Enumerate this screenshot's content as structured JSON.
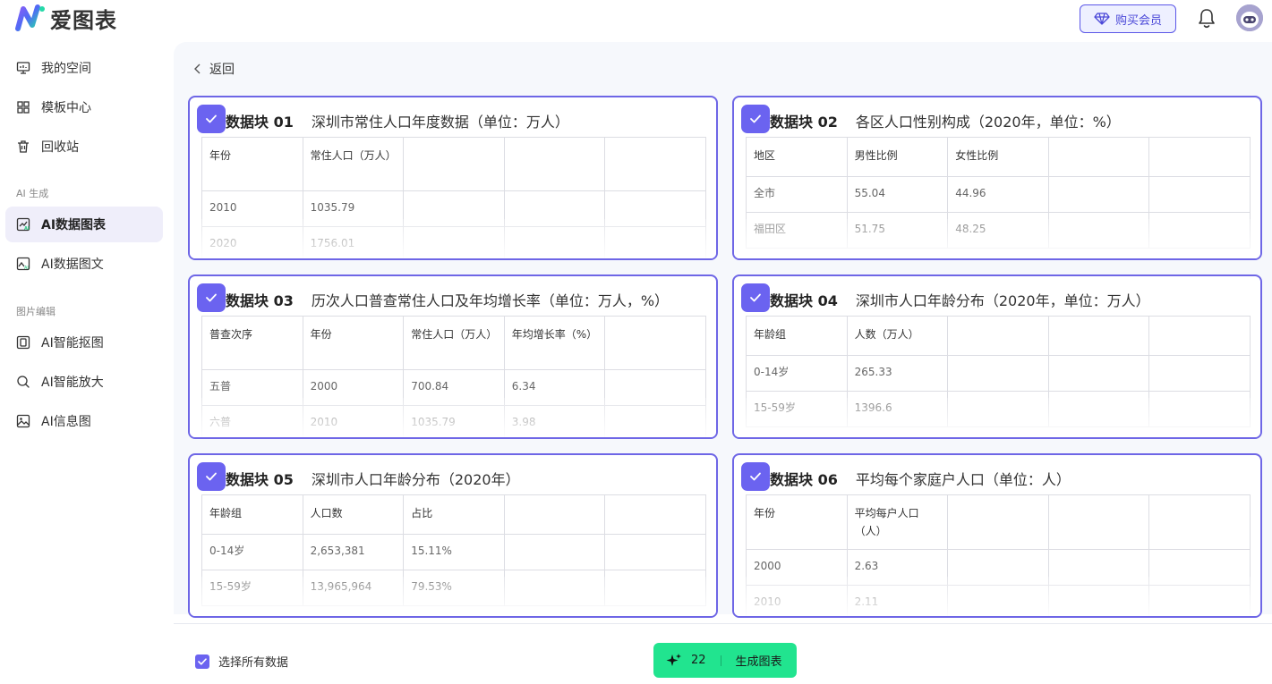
{
  "app": {
    "name": "爱图表"
  },
  "header": {
    "vip_label": "购买会员"
  },
  "sidebar": {
    "items": [
      {
        "label": "我的空间",
        "icon": "monitor-icon"
      },
      {
        "label": "模板中心",
        "icon": "grid-icon"
      },
      {
        "label": "回收站",
        "icon": "trash-icon"
      }
    ],
    "section_ai": "AI 生成",
    "ai_items": [
      {
        "label": "AI数据图表",
        "icon": "ai-chart-icon",
        "active": true
      },
      {
        "label": "AI数据图文",
        "icon": "ai-image-text-icon"
      }
    ],
    "section_edit": "图片编辑",
    "edit_items": [
      {
        "label": "AI智能抠图",
        "icon": "cutout-icon"
      },
      {
        "label": "AI智能放大",
        "icon": "magnify-icon"
      },
      {
        "label": "AI信息图",
        "icon": "image-icon"
      }
    ]
  },
  "main": {
    "back_label": "返回",
    "cards": [
      {
        "label": "数据块 01",
        "title": "深圳市常住人口年度数据（单位：万人）",
        "headers": [
          "年份",
          "常住人口（万人）",
          "",
          "",
          ""
        ],
        "rows": [
          [
            "2010",
            "1035.79",
            "",
            "",
            ""
          ],
          [
            "2020",
            "1756.01",
            "",
            "",
            ""
          ]
        ]
      },
      {
        "label": "数据块 02",
        "title": "各区人口性别构成（2020年，单位：%）",
        "headers": [
          "地区",
          "男性比例",
          "女性比例",
          "",
          ""
        ],
        "rows": [
          [
            "全市",
            "55.04",
            "44.96",
            "",
            ""
          ],
          [
            "福田区",
            "51.75",
            "48.25",
            "",
            ""
          ]
        ]
      },
      {
        "label": "数据块 03",
        "title": "历次人口普查常住人口及年均增长率（单位：万人，%）",
        "headers": [
          "普查次序",
          "年份",
          "常住人口（万人）",
          "年均增长率（%）",
          ""
        ],
        "rows": [
          [
            "五普",
            "2000",
            "700.84",
            "6.34",
            ""
          ],
          [
            "六普",
            "2010",
            "1035.79",
            "3.98",
            ""
          ]
        ]
      },
      {
        "label": "数据块 04",
        "title": "深圳市人口年龄分布（2020年，单位：万人）",
        "headers": [
          "年龄组",
          "人数（万人）",
          "",
          "",
          ""
        ],
        "rows": [
          [
            "0-14岁",
            "265.33",
            "",
            "",
            ""
          ],
          [
            "15-59岁",
            "1396.6",
            "",
            "",
            ""
          ]
        ]
      },
      {
        "label": "数据块 05",
        "title": "深圳市人口年龄分布（2020年）",
        "headers": [
          "年龄组",
          "人口数",
          "占比",
          "",
          ""
        ],
        "rows": [
          [
            "0-14岁",
            "2,653,381",
            "15.11%",
            "",
            ""
          ],
          [
            "15-59岁",
            "13,965,964",
            "79.53%",
            "",
            ""
          ]
        ]
      },
      {
        "label": "数据块 06",
        "title": "平均每个家庭户人口（单位：人）",
        "headers": [
          "年份",
          "平均每户人口（人）",
          "",
          "",
          ""
        ],
        "rows": [
          [
            "2000",
            "2.63",
            "",
            "",
            ""
          ],
          [
            "2010",
            "2.11",
            "",
            "",
            ""
          ]
        ]
      }
    ]
  },
  "footer": {
    "select_all_label": "选择所有数据",
    "credits": "22",
    "generate_label": "生成图表"
  },
  "colors": {
    "accent": "#6b63f0",
    "generate": "#21e48f",
    "card_border": "#6e66e6"
  }
}
